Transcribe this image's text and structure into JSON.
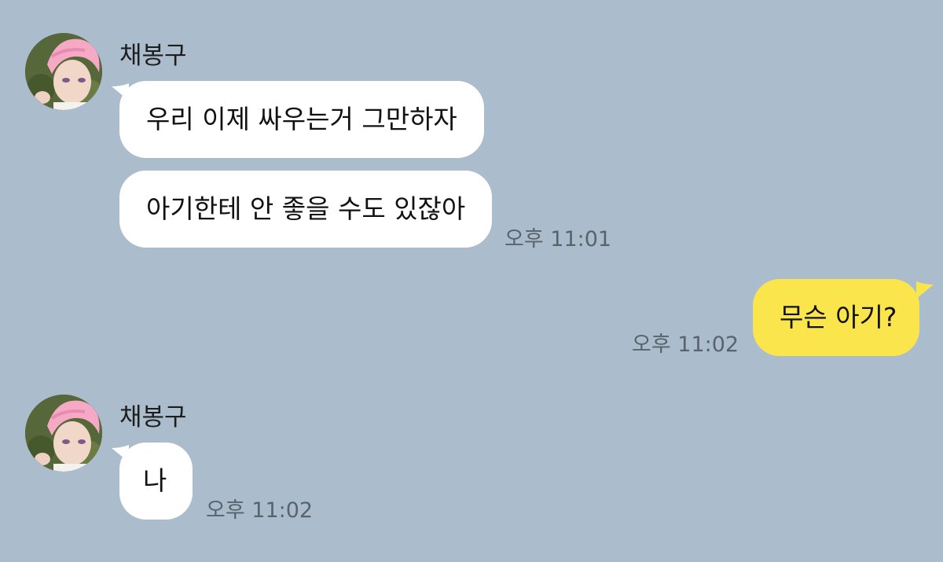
{
  "chat": {
    "theme": {
      "background": "#abbdcd",
      "incoming_bubble": "#ffffff",
      "outgoing_bubble": "#fbe54d"
    },
    "blocks": [
      {
        "sender": "채봉구",
        "avatar_icon": "profile-avatar-pink-hair",
        "messages": [
          "우리 이제 싸우는거 그만하자",
          "아기한테 안 좋을 수도 있잖아"
        ],
        "time": "오후 11:01"
      },
      {
        "sender": "me",
        "messages": [
          "무슨 아기?"
        ],
        "time": "오후 11:02"
      },
      {
        "sender": "채봉구",
        "avatar_icon": "profile-avatar-pink-hair",
        "messages": [
          "나"
        ],
        "time": "오후 11:02"
      }
    ]
  }
}
